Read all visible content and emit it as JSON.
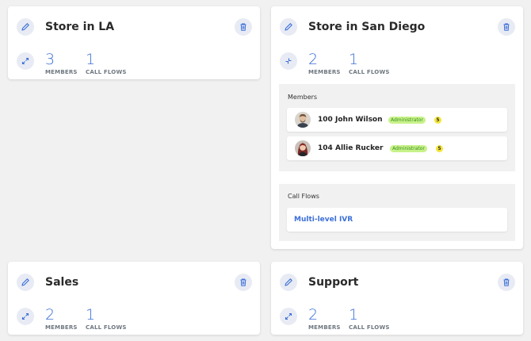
{
  "accent_color": "#3b6fd8",
  "groups": [
    {
      "name": "Store in LA",
      "members_count": "3",
      "members_label": "MEMBERS",
      "call_flows_count": "1",
      "call_flows_label": "CALL FLOWS",
      "expanded": false,
      "icons": [
        "pencil-icon",
        "trash-icon",
        "expand-icon"
      ]
    },
    {
      "name": "Store in San Diego",
      "members_count": "2",
      "members_label": "MEMBERS",
      "call_flows_count": "1",
      "call_flows_label": "CALL FLOWS",
      "expanded": true,
      "icons": [
        "pencil-icon",
        "trash-icon",
        "collapse-icon"
      ],
      "members_section_title": "Members",
      "members": [
        {
          "extension": "100",
          "name": "John Wilson",
          "role": "Administrator",
          "count": "5"
        },
        {
          "extension": "104",
          "name": "Allie Rucker",
          "role": "Administrator",
          "count": "5"
        }
      ],
      "call_flows_section_title": "Call Flows",
      "call_flows": [
        {
          "name": "Multi-level IVR"
        }
      ]
    },
    {
      "name": "Sales",
      "members_count": "2",
      "members_label": "MEMBERS",
      "call_flows_count": "1",
      "call_flows_label": "CALL FLOWS",
      "expanded": false,
      "icons": [
        "pencil-icon",
        "trash-icon",
        "expand-icon"
      ]
    },
    {
      "name": "Support",
      "members_count": "2",
      "members_label": "MEMBERS",
      "call_flows_count": "1",
      "call_flows_label": "CALL FLOWS",
      "expanded": false,
      "icons": [
        "pencil-icon",
        "trash-icon",
        "expand-icon"
      ]
    }
  ]
}
